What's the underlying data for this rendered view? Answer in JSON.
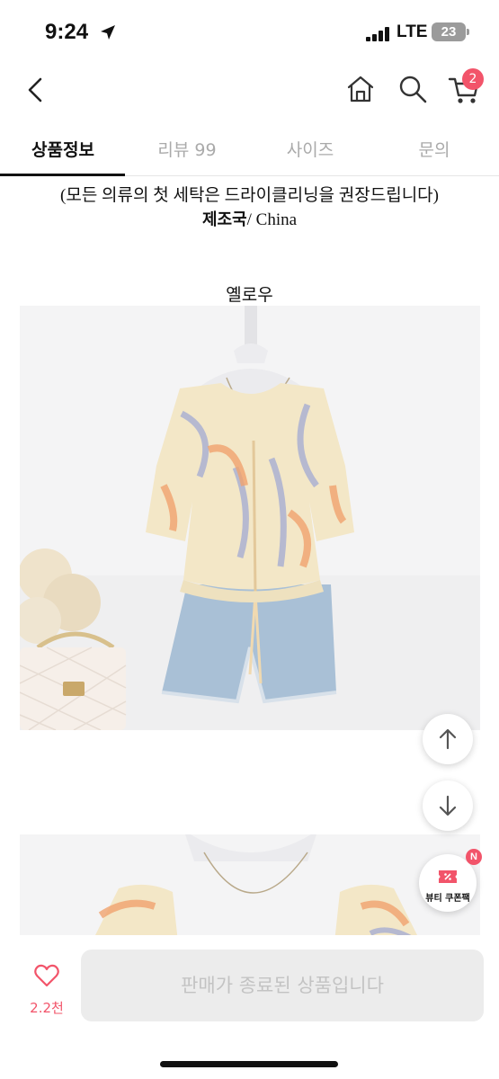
{
  "status_bar": {
    "time": "9:24",
    "network": "LTE",
    "battery": "23"
  },
  "header": {
    "cart_count": "2"
  },
  "tabs": [
    {
      "label": "상품정보",
      "active": true
    },
    {
      "label": "리뷰 99",
      "active": false
    },
    {
      "label": "사이즈",
      "active": false
    },
    {
      "label": "문의",
      "active": false
    }
  ],
  "content": {
    "care_note": "(모든 의류의 첫 세탁은 드라이클리닝을 권장드립니다)",
    "origin_label": "제조국",
    "origin_value": "/ China",
    "color_label": "옐로우"
  },
  "floating": {
    "coupon_label": "뷰티 쿠폰팩",
    "coupon_badge": "N"
  },
  "bottom": {
    "like_count": "2.2천",
    "status_button": "판매가 종료된 상품입니다"
  },
  "colors": {
    "accent": "#f2546a",
    "disabled_bg": "#ececec",
    "disabled_text": "#c3c3c3"
  },
  "icons": [
    "location-arrow-icon",
    "back-chevron-icon",
    "home-icon",
    "search-icon",
    "cart-icon",
    "arrow-up-icon",
    "arrow-down-icon",
    "coupon-icon",
    "heart-icon"
  ]
}
